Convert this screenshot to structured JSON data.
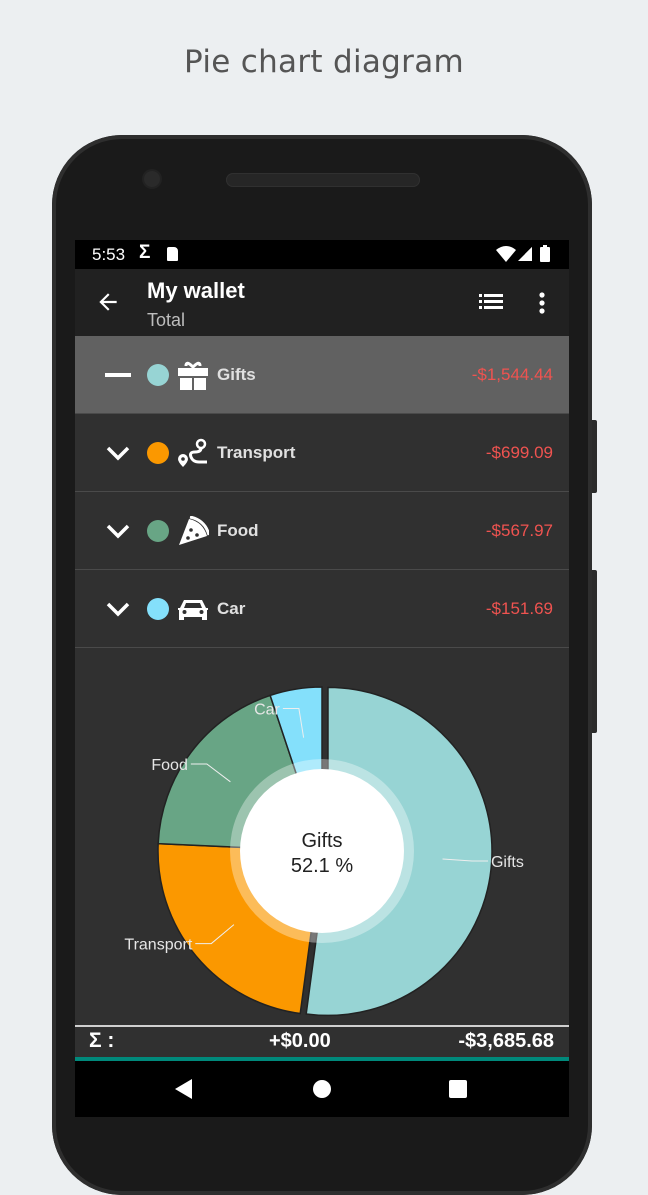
{
  "caption": "Pie chart diagram",
  "status_bar": {
    "time": "5:53",
    "icons": [
      "sigma-icon",
      "sd-card-icon",
      "wifi-icon",
      "signal-icon",
      "battery-icon"
    ]
  },
  "app_bar": {
    "title": "My wallet",
    "subtitle": "Total",
    "actions": [
      "back-arrow-icon",
      "list-icon",
      "more-vert-icon"
    ]
  },
  "categories": [
    {
      "name": "Gifts",
      "amount": "-$1,544.44",
      "color": "#97d4d4",
      "icon": "gift-icon",
      "expanded": true,
      "selected": true
    },
    {
      "name": "Transport",
      "amount": "-$699.09",
      "color": "#fb9800",
      "icon": "route-icon",
      "expanded": false,
      "selected": false
    },
    {
      "name": "Food",
      "amount": "-$567.97",
      "color": "#68a585",
      "icon": "pizza-icon",
      "expanded": false,
      "selected": false
    },
    {
      "name": "Car",
      "amount": "-$151.69",
      "color": "#84e0fb",
      "icon": "car-icon",
      "expanded": false,
      "selected": false
    }
  ],
  "chart_data": {
    "type": "pie",
    "donut": true,
    "categories": [
      "Gifts",
      "Transport",
      "Food",
      "Car"
    ],
    "values": [
      1544.44,
      699.09,
      567.97,
      151.69
    ],
    "colors": [
      "#97d4d4",
      "#fb9800",
      "#68a585",
      "#84e0fb"
    ],
    "highlighted": "Gifts",
    "center_label": "Gifts",
    "center_value": "52.1 %",
    "start_angle": "top",
    "direction": "clockwise"
  },
  "summary": {
    "sigma": "Σ :",
    "income": "+$0.00",
    "total": "-$3,685.68",
    "accent_color": "#00897b"
  },
  "nav_bar": [
    "nav-back-icon",
    "nav-home-icon",
    "nav-recents-icon"
  ]
}
